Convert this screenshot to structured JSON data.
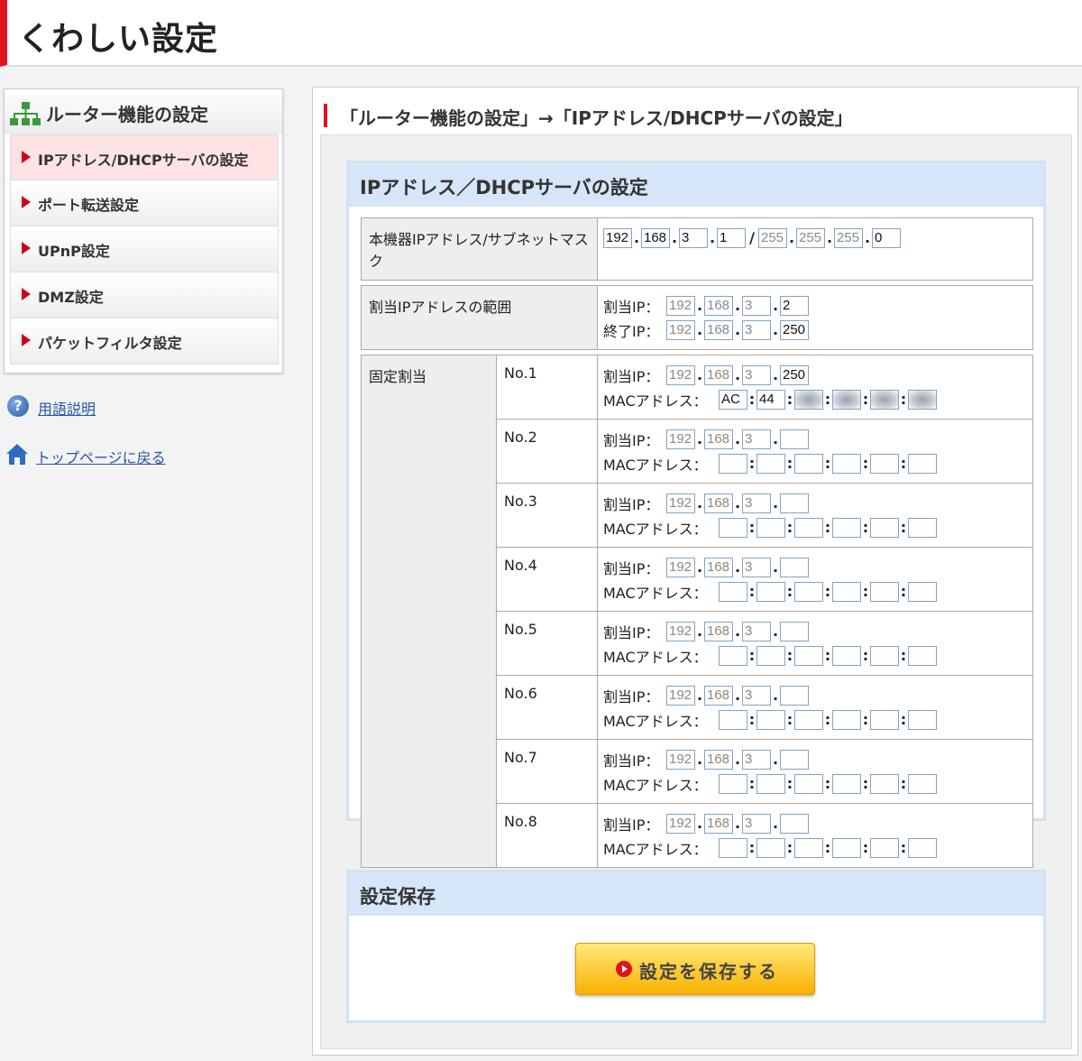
{
  "header": {
    "title": "くわしい設定"
  },
  "sidebar": {
    "title": "ルーター機能の設定",
    "items": [
      {
        "label": "IPアドレス/DHCPサーバの設定",
        "active": true
      },
      {
        "label": "ポート転送設定"
      },
      {
        "label": "UPnP設定"
      },
      {
        "label": "DMZ設定"
      },
      {
        "label": "パケットフィルタ設定"
      }
    ],
    "help_link": "用語説明",
    "home_link": "トップページに戻る"
  },
  "main": {
    "breadcrumb": "「ルーター機能の設定」→「IPアドレス/DHCPサーバの設定」",
    "section_title": "IPアドレス／DHCPサーバの設定",
    "device_ip": {
      "label": "本機器IPアドレス/サブネットマスク",
      "ip": [
        "192",
        "168",
        "3",
        "1"
      ],
      "mask": [
        "255",
        "255",
        "255",
        "0"
      ]
    },
    "range": {
      "label": "割当IPアドレスの範囲",
      "start_label": "割当IP：",
      "start": [
        "192",
        "168",
        "3",
        "2"
      ],
      "end_label": "終了IP：",
      "end": [
        "192",
        "168",
        "3",
        "250"
      ]
    },
    "fixed": {
      "label": "固定割当",
      "ip_label": "割当IP：",
      "mac_label": "MACアドレス：",
      "entries": [
        {
          "no": "No.1",
          "ip": [
            "192",
            "168",
            "3",
            "250"
          ],
          "mac": [
            "AC",
            "44",
            "",
            "",
            "",
            ""
          ]
        },
        {
          "no": "No.2",
          "ip": [
            "192",
            "168",
            "3",
            ""
          ],
          "mac": [
            "",
            "",
            "",
            "",
            "",
            ""
          ]
        },
        {
          "no": "No.3",
          "ip": [
            "192",
            "168",
            "3",
            ""
          ],
          "mac": [
            "",
            "",
            "",
            "",
            "",
            ""
          ]
        },
        {
          "no": "No.4",
          "ip": [
            "192",
            "168",
            "3",
            ""
          ],
          "mac": [
            "",
            "",
            "",
            "",
            "",
            ""
          ]
        },
        {
          "no": "No.5",
          "ip": [
            "192",
            "168",
            "3",
            ""
          ],
          "mac": [
            "",
            "",
            "",
            "",
            "",
            ""
          ]
        },
        {
          "no": "No.6",
          "ip": [
            "192",
            "168",
            "3",
            ""
          ],
          "mac": [
            "",
            "",
            "",
            "",
            "",
            ""
          ]
        },
        {
          "no": "No.7",
          "ip": [
            "192",
            "168",
            "3",
            ""
          ],
          "mac": [
            "",
            "",
            "",
            "",
            "",
            ""
          ]
        },
        {
          "no": "No.8",
          "ip": [
            "192",
            "168",
            "3",
            ""
          ],
          "mac": [
            "",
            "",
            "",
            "",
            "",
            ""
          ]
        }
      ]
    },
    "save_section_title": "設定保存",
    "save_button": "設定を保存する"
  },
  "colors": {
    "accent_red": "#e0141e",
    "link_blue": "#2956a3",
    "section_blue": "#d6e5f7",
    "button_yellow": "#f8b100"
  }
}
